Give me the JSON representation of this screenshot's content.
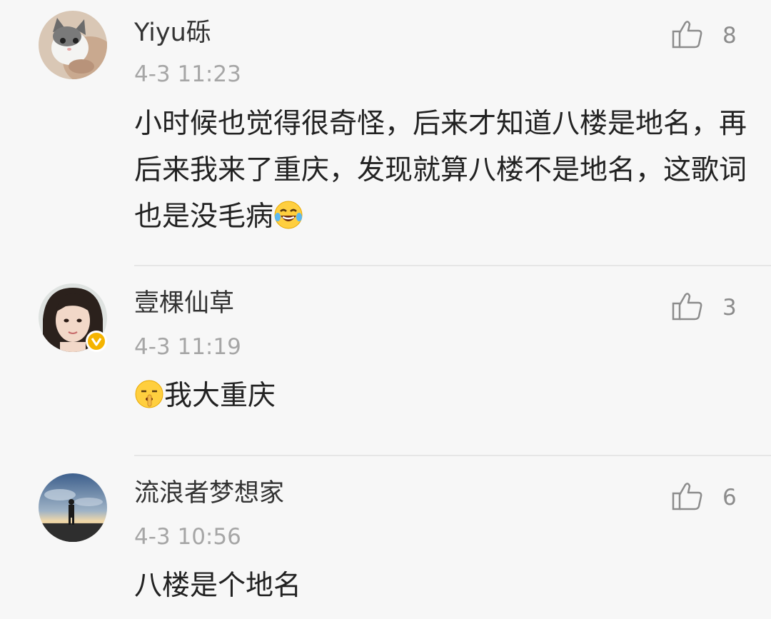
{
  "comments": [
    {
      "username": "Yiyu砾",
      "time": "4-3 11:23",
      "text": "小时候也觉得很奇怪，后来才知道八楼是地名，再后来我来了重庆，发现就算八楼不是地名，这歌词也是没毛病",
      "text_emoji": "laughing-tears-emoji",
      "likes": "8",
      "avatar": "kitten-avatar",
      "verified": false
    },
    {
      "username": "壹棵仙草",
      "time": "4-3 11:19",
      "text": "我大重庆",
      "text_emoji_before": "shushing-face-emoji",
      "likes": "3",
      "avatar": "woman-portrait-avatar",
      "verified": true,
      "badge_color": "#f5b400"
    },
    {
      "username": "流浪者梦想家",
      "time": "4-3 10:56",
      "text": "八楼是个地名",
      "likes": "6",
      "avatar": "silhouette-sunset-avatar",
      "verified": false
    }
  ],
  "colors": {
    "background": "#f7f7f7",
    "username": "#333333",
    "timestamp": "#a6a6a6",
    "body": "#222222",
    "like": "#8c8c8c",
    "divider": "#e6e6e6"
  }
}
